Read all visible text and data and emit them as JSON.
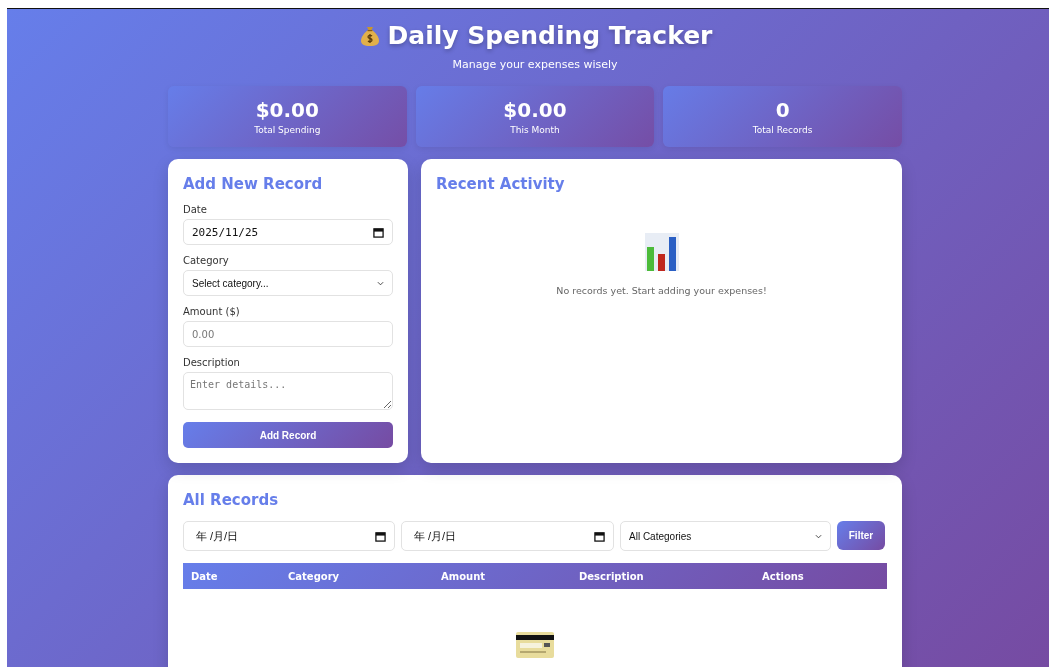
{
  "header": {
    "title": "Daily Spending Tracker",
    "subtitle": "Manage your expenses wisely"
  },
  "stats": [
    {
      "value": "$0.00",
      "label": "Total Spending"
    },
    {
      "value": "$0.00",
      "label": "This Month"
    },
    {
      "value": "0",
      "label": "Total Records"
    }
  ],
  "form": {
    "title": "Add New Record",
    "fields": [
      {
        "kind": "date",
        "label": "Date",
        "value": "2025/11/25"
      },
      {
        "kind": "select",
        "label": "Category",
        "value": "Select category..."
      },
      {
        "kind": "number",
        "label": "Amount ($)",
        "placeholder": "0.00"
      },
      {
        "kind": "textarea",
        "label": "Description",
        "placeholder": "Enter details..."
      }
    ],
    "button": "Add Record"
  },
  "activity": {
    "title": "Recent Activity",
    "empty_text": "No records yet. Start adding your expenses!"
  },
  "records": {
    "title": "All Records",
    "filters": [
      {
        "kind": "date",
        "placeholder": "年 /月/日"
      },
      {
        "kind": "date",
        "placeholder": "年 /月/日"
      },
      {
        "kind": "select",
        "value": "All Categories"
      }
    ],
    "filter_button": "Filter",
    "columns": [
      "Date",
      "Category",
      "Amount",
      "Description",
      "Actions"
    ]
  }
}
